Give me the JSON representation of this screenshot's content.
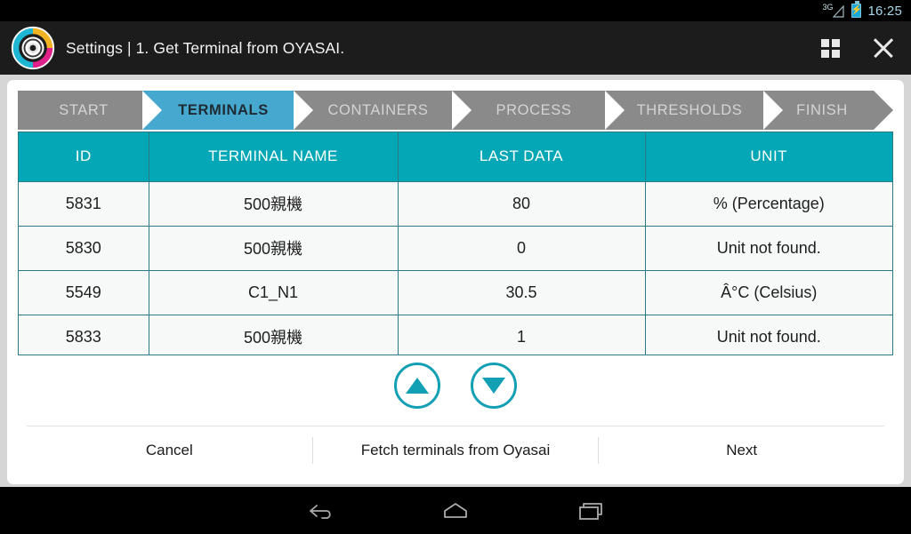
{
  "status_bar": {
    "network_label": "3G",
    "network_icon": "signal-triangle-icon",
    "battery_icon": "battery-charging-icon",
    "clock": "16:25"
  },
  "appbar": {
    "logo_icon": "app-logo-icon",
    "title": "Settings | 1. Get Terminal from OYASAI.",
    "grid_icon": "grid-view-icon",
    "close_icon": "close-icon"
  },
  "steps": [
    {
      "label": "START",
      "state": "dim"
    },
    {
      "label": "TERMINALS",
      "state": "active"
    },
    {
      "label": "CONTAINERS",
      "state": "dim"
    },
    {
      "label": "PROCESS",
      "state": "dim"
    },
    {
      "label": "THRESHOLDS",
      "state": "dim"
    },
    {
      "label": "FINISH",
      "state": "dim"
    }
  ],
  "table": {
    "columns": [
      "ID",
      "TERMINAL NAME",
      "LAST DATA",
      "UNIT"
    ],
    "rows": [
      {
        "id": "5831",
        "name": "500親機",
        "last_data": "80",
        "unit": "% (Percentage)"
      },
      {
        "id": "5830",
        "name": "500親機",
        "last_data": "0",
        "unit": "Unit not found."
      },
      {
        "id": "5549",
        "name": "C1_N1",
        "last_data": "30.5",
        "unit": "Â°C (Celsius)"
      },
      {
        "id": "5833",
        "name": "500親機",
        "last_data": "1",
        "unit": "Unit not found."
      },
      {
        "id": "",
        "name": "",
        "last_data": "",
        "unit": ""
      }
    ]
  },
  "scroll_controls": {
    "up_icon": "arrow-up-circle-icon",
    "down_icon": "arrow-down-circle-icon"
  },
  "footer": {
    "cancel_label": "Cancel",
    "fetch_label": "Fetch terminals from Oyasai",
    "next_label": "Next"
  },
  "navbar": {
    "back_icon": "back-arrow-icon",
    "home_icon": "home-icon",
    "recents_icon": "recent-apps-icon"
  },
  "colors": {
    "header_teal": "#04a7b5",
    "active_step_blue": "#46a8ce",
    "inactive_step_gray": "#8a8a8a",
    "border_teal": "#2a7a87",
    "arrow_teal": "#13a0b4",
    "appbar_dark": "#1c1c1c",
    "page_gray": "#d6d6d6"
  }
}
